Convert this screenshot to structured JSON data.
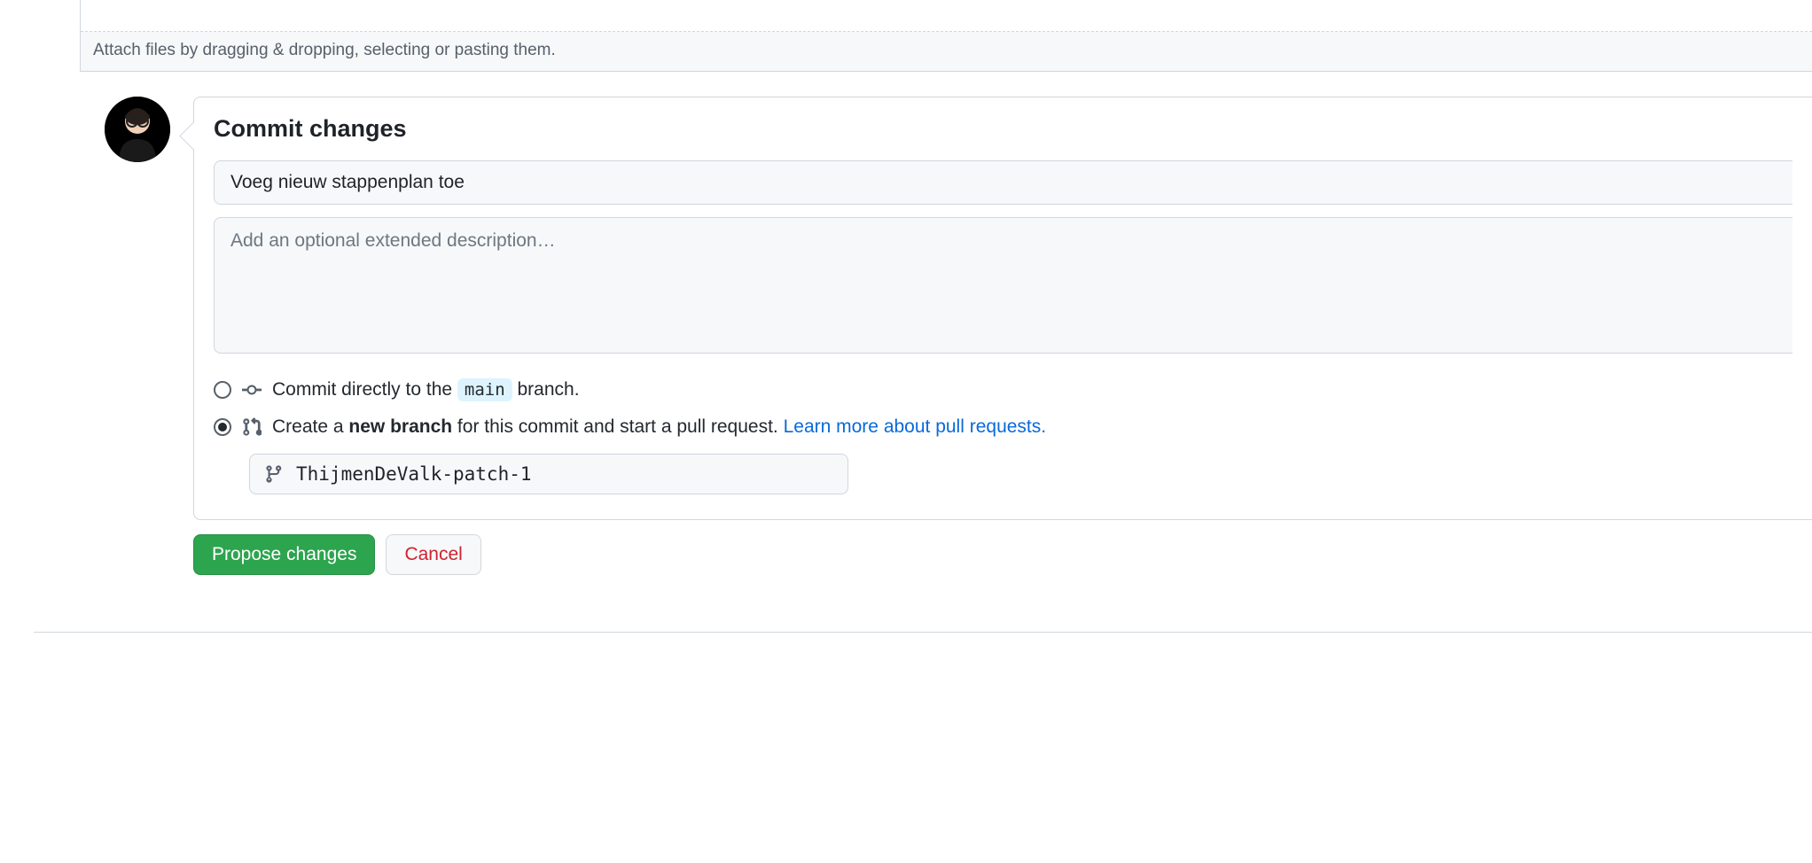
{
  "attach_bar": {
    "hint": "Attach files by dragging & dropping, selecting or pasting them."
  },
  "commit": {
    "heading": "Commit changes",
    "summary_value": "Voeg nieuw stappenplan toe",
    "description_placeholder": "Add an optional extended description…",
    "direct": {
      "prefix": "Commit directly to the ",
      "branch": "main",
      "suffix": " branch."
    },
    "new_branch": {
      "prefix": "Create a ",
      "bold": "new branch",
      "suffix": " for this commit and start a pull request. ",
      "learn_more": "Learn more about pull requests."
    },
    "branch_input_value": "ThijmenDeValk-patch-1"
  },
  "actions": {
    "propose": "Propose changes",
    "cancel": "Cancel"
  }
}
